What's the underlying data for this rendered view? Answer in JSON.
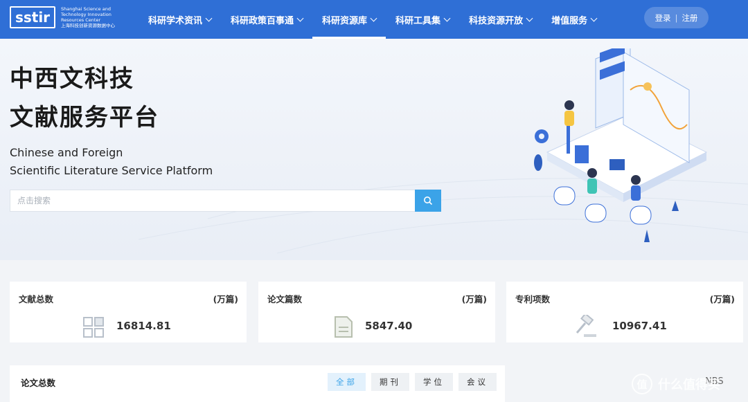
{
  "header": {
    "logo_mark": "sstir",
    "logo_text_en": "Shanghai Science and Technology Innovation Resources Center",
    "logo_text_cn": "上海科技创新资源数据中心",
    "nav": [
      {
        "label": "科研学术资讯"
      },
      {
        "label": "科研政策百事通"
      },
      {
        "label": "科研资源库"
      },
      {
        "label": "科研工具集"
      },
      {
        "label": "科技资源开放"
      },
      {
        "label": "增值服务"
      }
    ],
    "active_nav": "科研资源库",
    "login_label": "登录",
    "auth_sep": "|",
    "register_label": "注册"
  },
  "hero": {
    "title_line1": "中西文科技",
    "title_line2": "文献服务平台",
    "subtitle_line1": "Chinese and Foreign",
    "subtitle_line2": "Scientific Literature Service Platform",
    "search_placeholder": "点击搜索"
  },
  "stats": [
    {
      "label": "文献总数",
      "unit": "(万篇)",
      "value": "16814.81",
      "icon": "grid-icon"
    },
    {
      "label": "论文篇数",
      "unit": "(万篇)",
      "value": "5847.40",
      "icon": "document-icon"
    },
    {
      "label": "专利项数",
      "unit": "(万篇)",
      "value": "10967.41",
      "icon": "gavel-icon"
    }
  ],
  "panel": {
    "title": "论文总数",
    "tabs": [
      {
        "label": "全部"
      },
      {
        "label": "期刊"
      },
      {
        "label": "学位"
      },
      {
        "label": "会议"
      }
    ],
    "active_tab": "全部"
  },
  "side_text": "NBS",
  "watermark": {
    "glyph": "值",
    "text": "什么值得买"
  },
  "colors": {
    "header": "#2f6fd6",
    "accent": "#3ba3e8",
    "page_bg": "#f2f4f7"
  }
}
